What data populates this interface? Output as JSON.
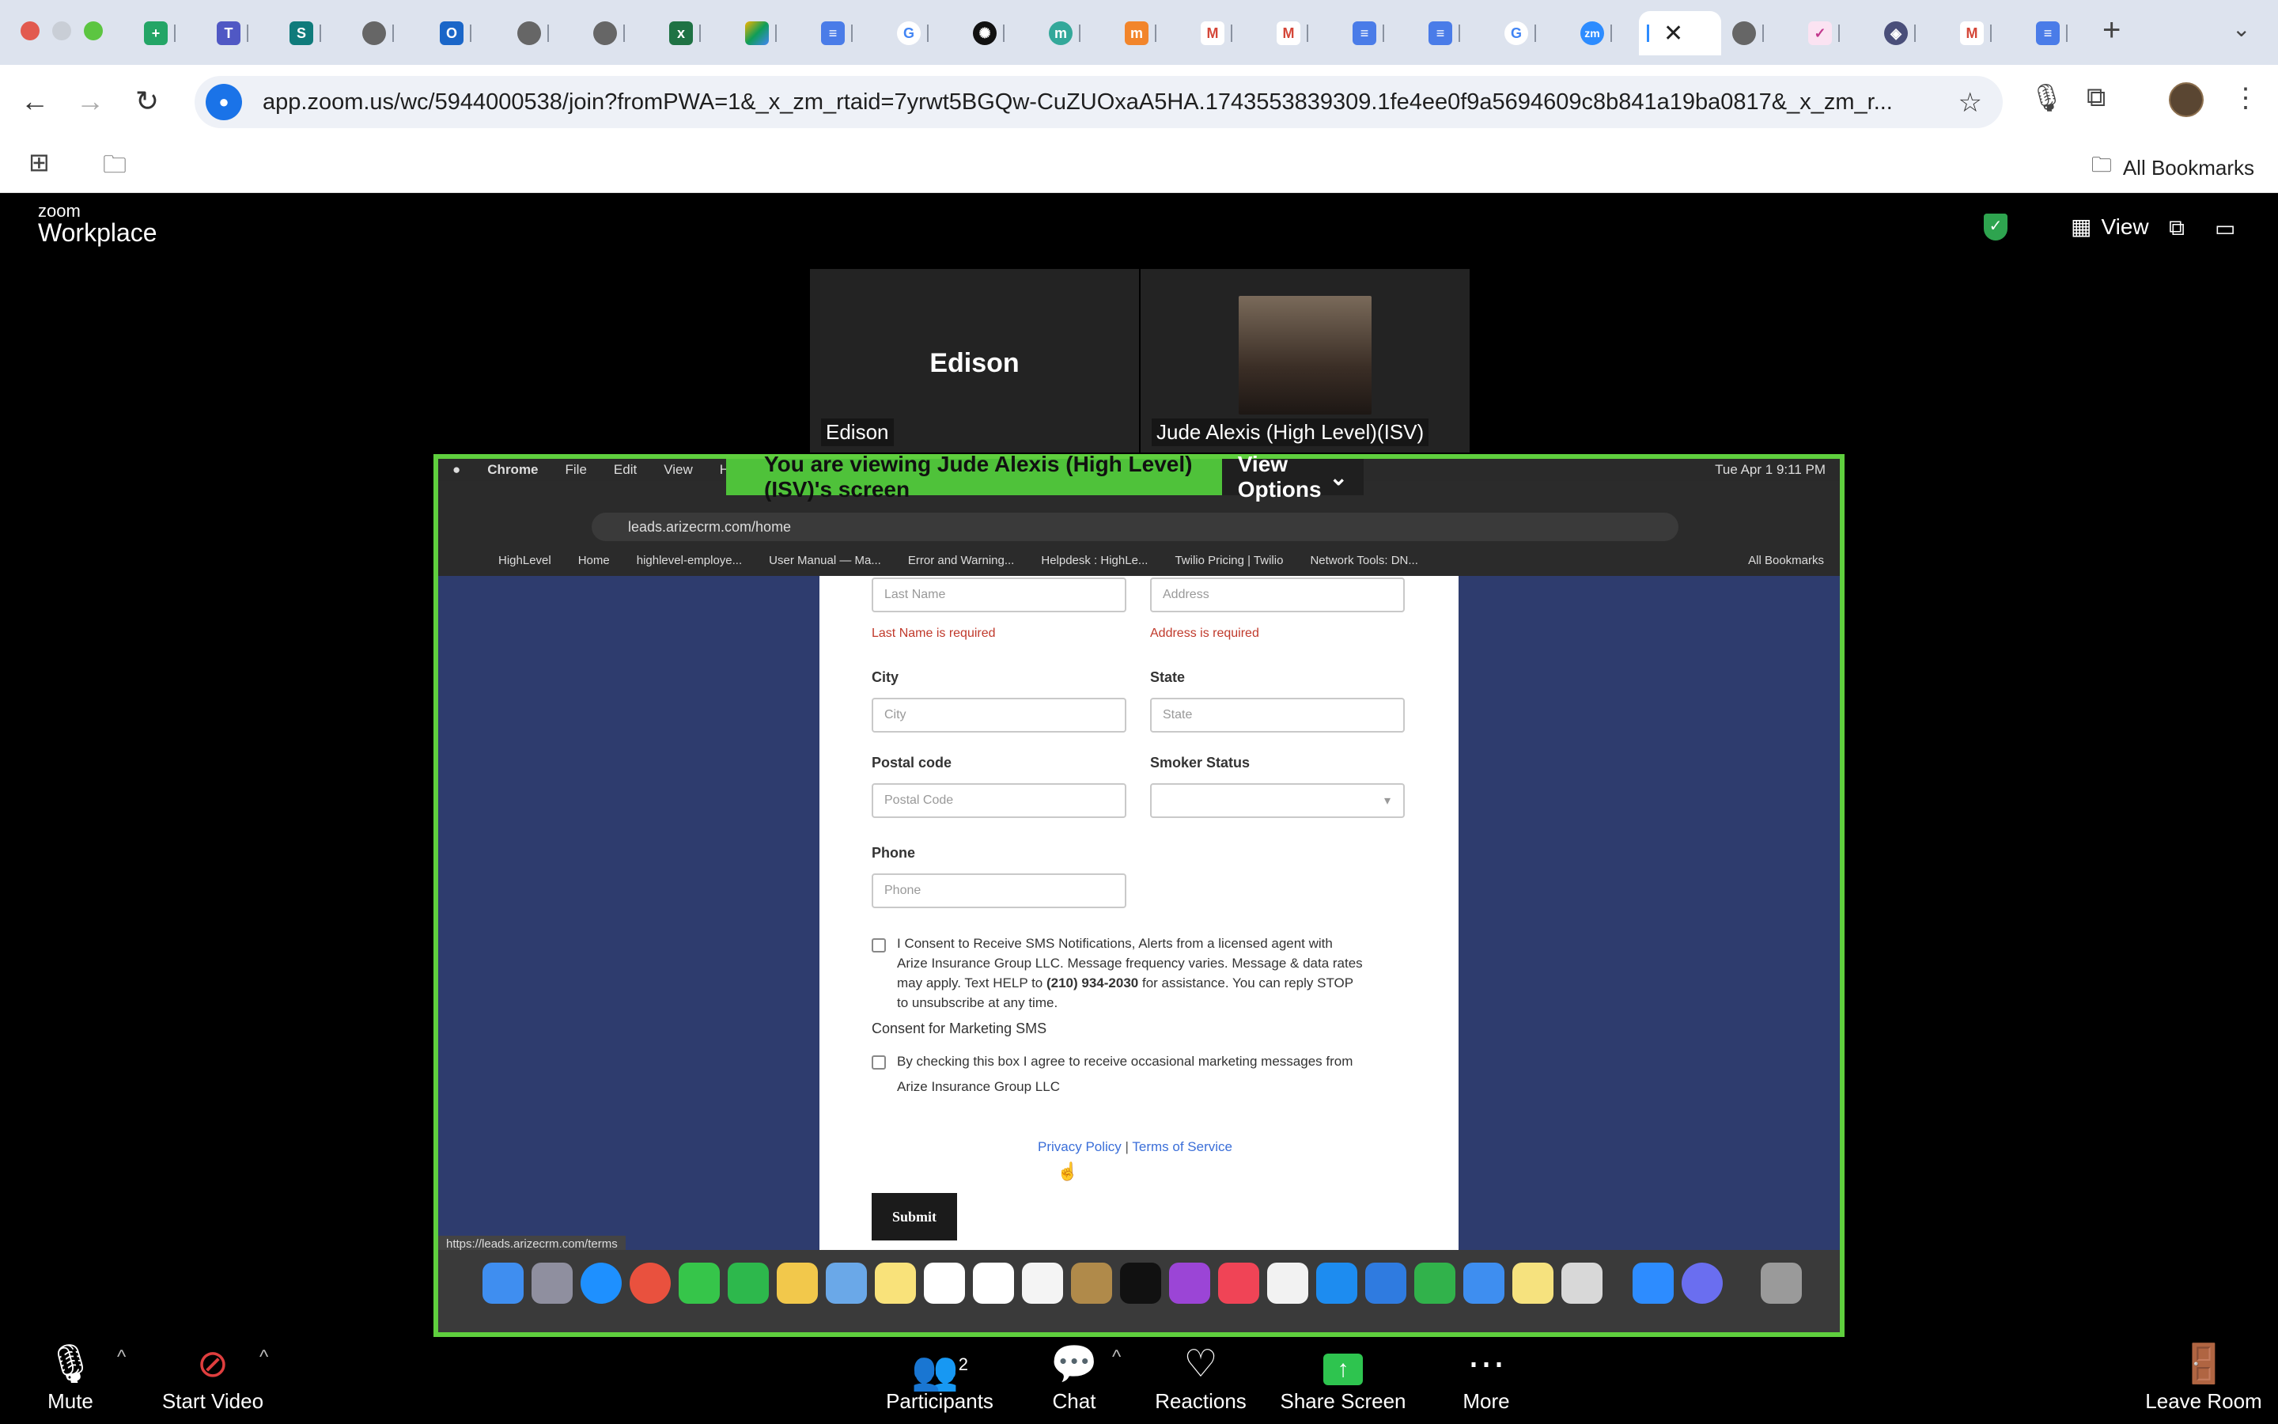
{
  "browser": {
    "url": "app.zoom.us/wc/5944000538/join?fromPWA=1&_x_zm_rtaid=7yrwt5BGQw-CuZUOxaA5HA.1743553839309.1fe4ee0f9a5694609c8b841a19ba0817&_x_zm_r...",
    "bookmarks_all_label": "All Bookmarks",
    "tab_favicons": [
      "sheets",
      "teams",
      "sharepoint",
      "globe",
      "outlook",
      "globe",
      "globe",
      "excel",
      "drive",
      "docs",
      "google",
      "openai",
      "m",
      "moodle",
      "gmail",
      "gmail",
      "docs",
      "docs",
      "google",
      "zoom",
      "zoom-active",
      "globe",
      "pink",
      "shield",
      "gmail",
      "docs"
    ]
  },
  "zoom": {
    "brand_small": "zoom",
    "brand_big": "Workplace",
    "view_label": "View",
    "participants": [
      {
        "name": "Edison",
        "display_text": "Edison"
      },
      {
        "name": "Jude Alexis (High Level)(ISV)"
      }
    ],
    "banner": {
      "text": "You are viewing  Jude Alexis (High Level)(ISV)'s screen",
      "options": "View Options"
    },
    "controls": {
      "mute": "Mute",
      "start_video": "Start Video",
      "participants": "Participants",
      "participants_count": "2",
      "chat": "Chat",
      "reactions": "Reactions",
      "share_screen": "Share Screen",
      "more": "More",
      "leave": "Leave Room"
    }
  },
  "shared": {
    "mac_menu": [
      "Chrome",
      "File",
      "Edit",
      "View",
      "Histo"
    ],
    "mac_clock": "Tue Apr 1  9:11 PM",
    "inner_url": "leads.arizecrm.com/home",
    "inner_bookmarks": [
      "HighLevel",
      "Home",
      "highlevel-employe...",
      "User Manual — Ma...",
      "Error and Warning...",
      "Helpdesk : HighLe...",
      "Twilio Pricing | Twilio",
      "Network Tools: DN..."
    ],
    "inner_all_bookmarks": "All Bookmarks",
    "status_url": "https://leads.arizecrm.com/terms",
    "form": {
      "last_name_placeholder": "Last Name",
      "address_placeholder": "Address",
      "last_name_error": "Last Name is required",
      "address_error": "Address is required",
      "city_label": "City",
      "city_placeholder": "City",
      "state_label": "State",
      "state_placeholder": "State",
      "postal_label": "Postal code",
      "postal_placeholder": "Postal Code",
      "smoker_label": "Smoker Status",
      "phone_label": "Phone",
      "phone_placeholder": "Phone",
      "consent_line1": "I Consent to Receive SMS Notifications, Alerts from a licensed agent with",
      "consent_line2": "Arize Insurance Group LLC. Message frequency varies. Message & data rates",
      "consent_line3a": "may apply. Text HELP to ",
      "consent_phone": "(210) 934-2030",
      "consent_line3b": " for assistance. You can reply STOP",
      "consent_line4": "to unsubscribe at any time.",
      "marketing_label": "Consent for Marketing SMS",
      "marketing_line1": "By checking this box I agree to receive occasional marketing messages from",
      "marketing_line2": "Arize Insurance Group LLC",
      "privacy": "Privacy Policy",
      "sep": " | ",
      "terms": "Terms of Service",
      "submit": "Submit"
    }
  },
  "colors": {
    "share_border": "#5fcf3e",
    "banner": "#4fc23a",
    "page_bg": "#2e3c6e",
    "error": "#c0392b",
    "link": "#3a6ed8"
  }
}
